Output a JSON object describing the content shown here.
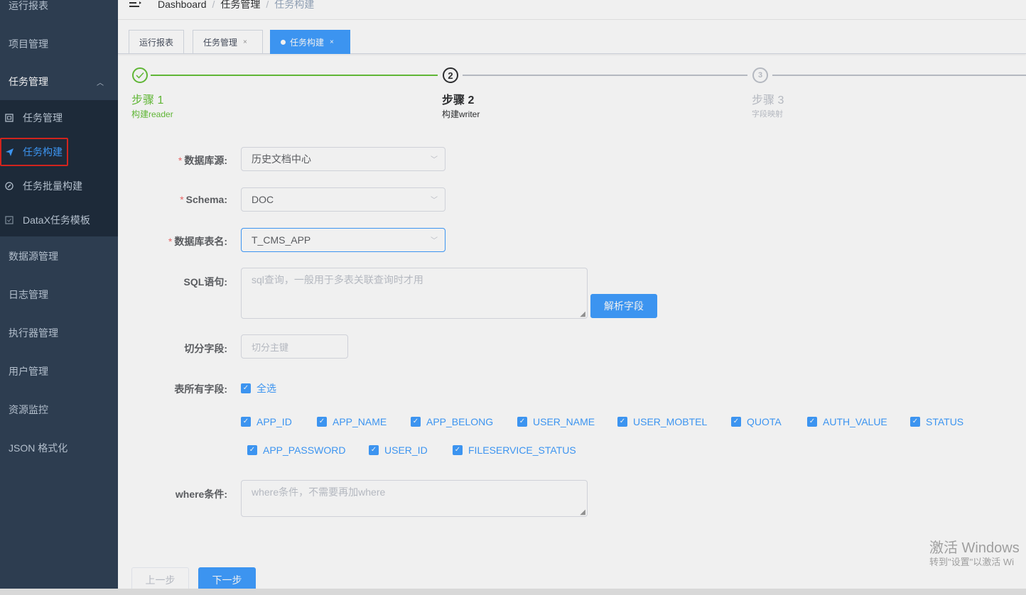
{
  "sidebar": {
    "items": [
      {
        "label": "运行报表"
      },
      {
        "label": "项目管理"
      },
      {
        "label": "任务管理"
      },
      {
        "label": "数据源管理"
      },
      {
        "label": "日志管理"
      },
      {
        "label": "执行器管理"
      },
      {
        "label": "用户管理"
      },
      {
        "label": "资源监控"
      },
      {
        "label": "JSON 格式化"
      }
    ],
    "subitems": [
      {
        "label": "任务管理",
        "icon": "calendar-icon"
      },
      {
        "label": "任务构建",
        "icon": "paper-plane-icon",
        "active": true
      },
      {
        "label": "任务批量构建",
        "icon": "dashboard-icon"
      },
      {
        "label": "DataX任务模板",
        "icon": "template-icon"
      }
    ]
  },
  "breadcrumb": [
    "Dashboard",
    "任务管理",
    "任务构建"
  ],
  "tags": [
    {
      "label": "运行报表"
    },
    {
      "label": "任务管理",
      "close": "×"
    },
    {
      "label": "任务构建",
      "close": "×",
      "active": true
    }
  ],
  "steps": [
    {
      "index": "1",
      "title": "步骤 1",
      "desc": "构建reader",
      "status": "success"
    },
    {
      "index": "2",
      "title": "步骤 2",
      "desc": "构建writer",
      "status": "process"
    },
    {
      "index": "3",
      "title": "步骤 3",
      "desc": "字段映射",
      "status": "wait"
    }
  ],
  "form": {
    "datasource": {
      "label": "数据库源:",
      "value": "历史文档中心"
    },
    "schema": {
      "label": "Schema:",
      "value": "DOC"
    },
    "table": {
      "label": "数据库表名:",
      "value": "T_CMS_APP"
    },
    "sql": {
      "label": "SQL语句:",
      "placeholder": "sql查询，一般用于多表关联查询时才用"
    },
    "parse_button": "解析字段",
    "split": {
      "label": "切分字段:",
      "placeholder": "切分主键"
    },
    "all_fields": {
      "label": "表所有字段:",
      "select_all": "全选"
    },
    "fields": [
      "APP_ID",
      "APP_NAME",
      "APP_BELONG",
      "USER_NAME",
      "USER_MOBTEL",
      "QUOTA",
      "AUTH_VALUE",
      "STATUS",
      "APP_PASSWORD",
      "USER_ID",
      "FILESERVICE_STATUS"
    ],
    "where": {
      "label": "where条件:",
      "placeholder": "where条件，不需要再加where"
    }
  },
  "buttons": {
    "prev": "上一步",
    "next": "下一步"
  },
  "watermark": {
    "line1": "激活 Windows",
    "line2": "转到\"设置\"以激活 Wi"
  }
}
